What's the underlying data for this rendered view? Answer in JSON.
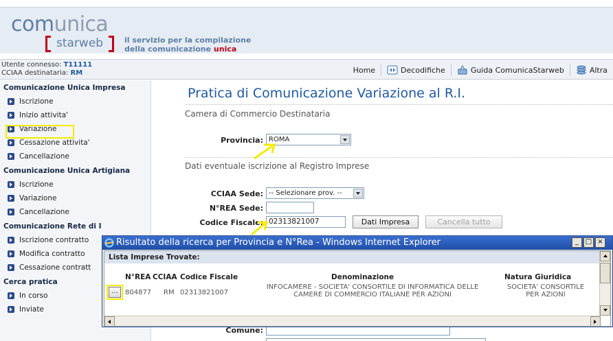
{
  "header": {
    "logo_word1": "com",
    "logo_word1b": "unica",
    "logo_word2": "starweb",
    "tagline_line1": "il servizio per la compilazione",
    "tagline_line2a": "della comunicazione ",
    "tagline_line2b": "unica"
  },
  "infobar": {
    "user_label": "Utente connesso: ",
    "user_value": "T11111",
    "cciaa_label": "CCIAA destinataria: ",
    "cciaa_value": "RM",
    "nav": [
      {
        "label": "Home"
      },
      {
        "label": "Decodifiche",
        "icon": "decodifiche-icon"
      },
      {
        "label": "Guida ComunicaStarweb",
        "icon": "guide-icon"
      },
      {
        "label": "Altra",
        "icon": "stack-icon"
      }
    ]
  },
  "sidebar": {
    "sections": [
      {
        "title": "Comunicazione Unica Impresa",
        "items": [
          "Iscrizione",
          "Inizio attivita'",
          "Variazione",
          "Cessazione attivita'",
          "Cancellazione"
        ]
      },
      {
        "title": "Comunicazione Unica Artigiana",
        "items": [
          "Iscrizione",
          "Variazione",
          "Cancellazione"
        ]
      },
      {
        "title": "Comunicazione Rete di I",
        "items": [
          "Iscrizione contratto",
          "Modifica contratto",
          "Cessazione contratt"
        ]
      },
      {
        "title": "Cerca pratica",
        "items": [
          "In corso",
          "Inviate"
        ]
      }
    ]
  },
  "main": {
    "title": "Pratica di Comunicazione Variazione al R.I.",
    "section1": "Camera di Commercio Destinataria",
    "provincia_label": "Provincia:",
    "provincia_value": "ROMA",
    "section2": "Dati eventuale iscrizione al Registro Imprese",
    "cciaa_sede_label": "CCIAA Sede:",
    "cciaa_sede_value": "-- Selezionare prov. --",
    "nrea_sede_label": "N°REA Sede:",
    "nrea_sede_value": "",
    "codice_fiscale_label": "Codice Fiscale:",
    "codice_fiscale_value": "02313821007",
    "dati_impresa_btn": "Dati Impresa",
    "cancella_tutto_btn": "Cancella tutto",
    "comune_label": "Comune:",
    "comune_value": ""
  },
  "popup": {
    "title": "Risultato della ricerca per Provincia e N°Rea - Windows Internet Explorer",
    "list_title": "Lista Imprese Trovate:",
    "columns": [
      "N°REA",
      "CCIAA",
      "Codice Fiscale",
      "Denominazione",
      "Natura Giuridica"
    ],
    "row": {
      "button": "...",
      "nrea": "804877",
      "cciaa": "RM",
      "codice_fiscale": "02313821007",
      "denominazione_1": "INFOCAMERE - SOCIETA' CONSORTILE DI INFORMATICA DELLE",
      "denominazione_2": "CAMERE DI COMMERCIO ITALIANE PER AZIONI",
      "natura_1": "SOCIETA' CONSORTILE",
      "natura_2": "PER AZIONI"
    },
    "win_buttons": [
      "_",
      "□",
      "×"
    ]
  },
  "colors": {
    "accent_blue": "#1f5aa6",
    "highlight_yellow": "#f5ea00",
    "brand_red": "#c2001a"
  }
}
